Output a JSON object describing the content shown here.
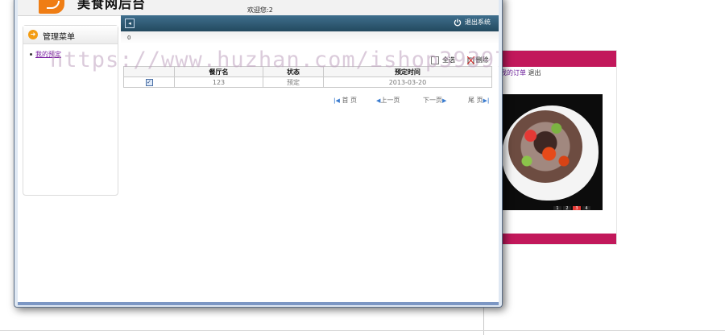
{
  "header": {
    "logo_text": "美食网后台",
    "welcome": "欢迎您:2"
  },
  "nav": {
    "logout_label": "退出系统",
    "substrip_text": "0"
  },
  "sidebar": {
    "title": "管理菜单",
    "items": [
      {
        "label": "我的预定"
      }
    ]
  },
  "toolbar": {
    "select_all_label": "全选",
    "delete_label": "删除"
  },
  "table": {
    "columns": [
      "",
      "餐厅名",
      "状态",
      "预定时间"
    ],
    "rows": [
      {
        "checked": true,
        "restaurant": "123",
        "status": "预定",
        "time": "2013-03-20"
      }
    ]
  },
  "pager": {
    "first": "首 页",
    "prev": "上一页",
    "next": "下一页",
    "last": "尾 页"
  },
  "background": {
    "ad_link_1": "我的订单",
    "ad_link_2": "退出",
    "slides": [
      "1",
      "2",
      "3",
      "4"
    ],
    "active_slide": 3
  },
  "watermark": "https://www.huzhan.com/ishop39397",
  "colors": {
    "nav_bar": "#2f5a73",
    "accent_orange": "#f39c12",
    "ad_magenta": "#c2185b",
    "link_purple": "#7b1fa2"
  }
}
